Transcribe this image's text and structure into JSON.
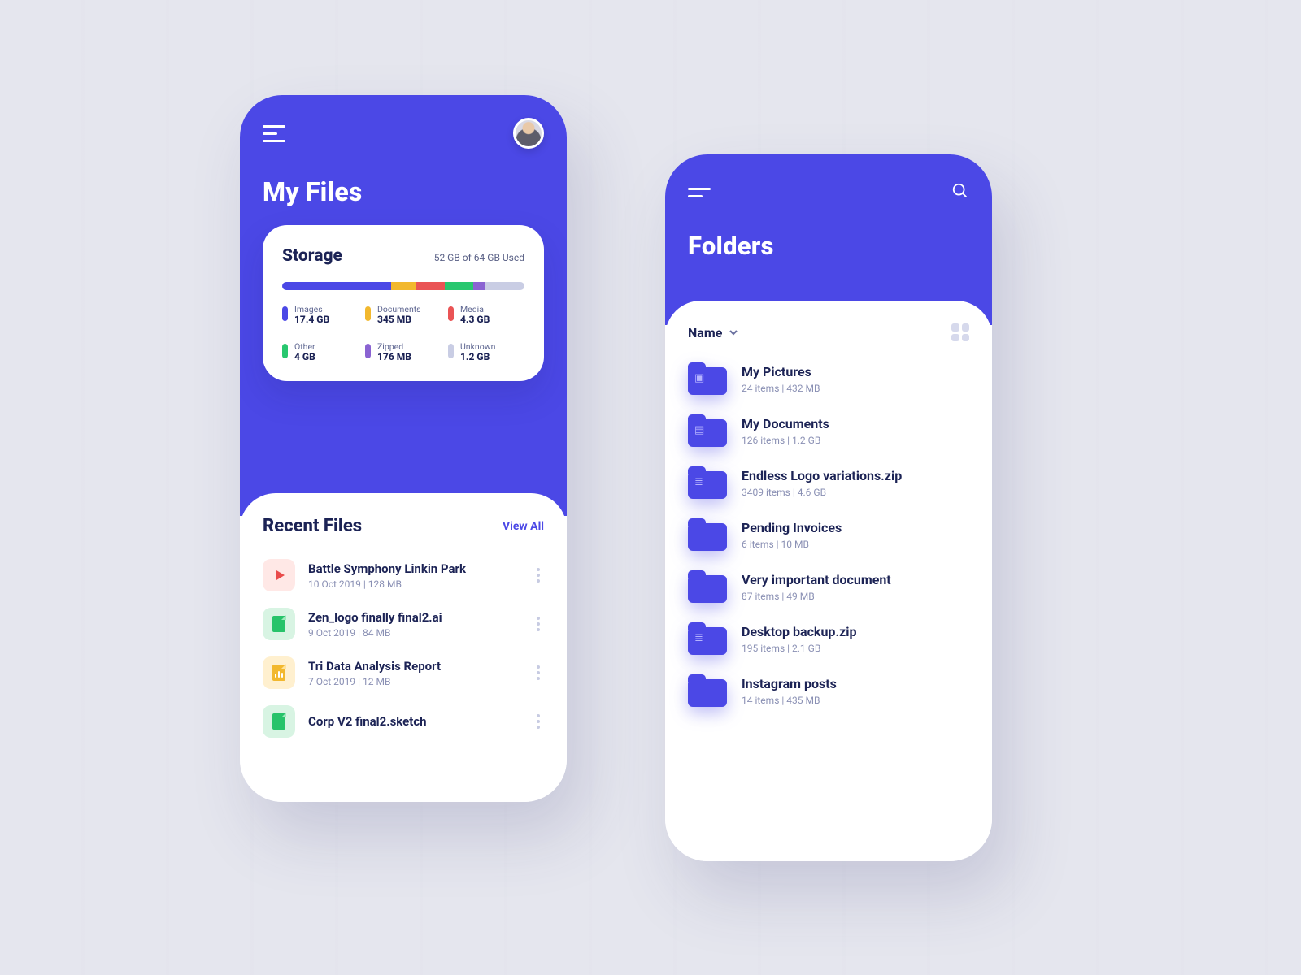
{
  "colors": {
    "images": "#4b48e6",
    "documents": "#f2b82e",
    "media": "#ea5455",
    "other": "#28c76f",
    "zipped": "#8a63d2",
    "unknown": "#c9cde4"
  },
  "left": {
    "title": "My Files",
    "storage": {
      "heading": "Storage",
      "summary": "52 GB of 64 GB Used",
      "segments": [
        {
          "key": "images",
          "label": "Images",
          "value": "17.4 GB",
          "pct": 45
        },
        {
          "key": "documents",
          "label": "Documents",
          "value": "345 MB",
          "pct": 10
        },
        {
          "key": "media",
          "label": "Media",
          "value": "4.3 GB",
          "pct": 12
        },
        {
          "key": "other",
          "label": "Other",
          "value": "4 GB",
          "pct": 12
        },
        {
          "key": "zipped",
          "label": "Zipped",
          "value": "176 MB",
          "pct": 5
        },
        {
          "key": "unknown",
          "label": "Unknown",
          "value": "1.2 GB",
          "pct": 16
        }
      ]
    },
    "recent": {
      "heading": "Recent Files",
      "view_all": "View All",
      "files": [
        {
          "icon": "video",
          "name": "Battle Symphony Linkin Park",
          "date": "10 Oct 2019",
          "size": "128 MB"
        },
        {
          "icon": "green",
          "name": "Zen_logo finally final2.ai",
          "date": "9 Oct 2019",
          "size": "84 MB"
        },
        {
          "icon": "yellow",
          "name": "Tri Data Analysis Report",
          "date": "7 Oct 2019",
          "size": "12 MB"
        },
        {
          "icon": "green",
          "name": "Corp V2 final2.sketch",
          "date": "",
          "size": ""
        }
      ]
    }
  },
  "right": {
    "title": "Folders",
    "sort_label": "Name",
    "folders": [
      {
        "glyph": "image",
        "name": "My Pictures",
        "items": "24 items",
        "size": "432 MB"
      },
      {
        "glyph": "doc",
        "name": "My Documents",
        "items": "126 items",
        "size": "1.2 GB"
      },
      {
        "glyph": "zip",
        "name": "Endless Logo variations.zip",
        "items": "3409 items",
        "size": "4.6 GB"
      },
      {
        "glyph": "",
        "name": "Pending Invoices",
        "items": "6 items",
        "size": "10 MB"
      },
      {
        "glyph": "",
        "name": "Very important document",
        "items": "87 items",
        "size": "49 MB"
      },
      {
        "glyph": "zip",
        "name": "Desktop backup.zip",
        "items": "195 items",
        "size": "2.1 GB"
      },
      {
        "glyph": "",
        "name": "Instagram posts",
        "items": "14 items",
        "size": "435 MB"
      }
    ]
  }
}
